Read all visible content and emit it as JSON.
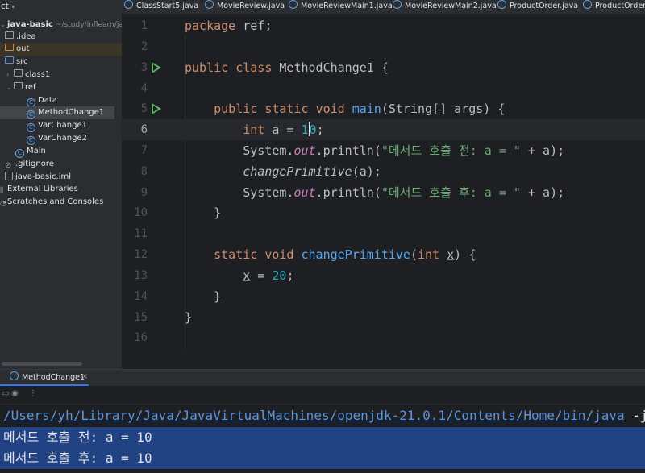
{
  "project": {
    "header": "ct",
    "root_name": "java-basic",
    "root_path": "~/study/inflearn/java/",
    "items": [
      {
        "label": ".idea",
        "kind": "folder"
      },
      {
        "label": "out",
        "kind": "folder-orange"
      },
      {
        "label": "src",
        "kind": "folder-blue"
      },
      {
        "label": "class1",
        "kind": "package"
      },
      {
        "label": "ref",
        "kind": "package"
      },
      {
        "label": "Data",
        "kind": "class"
      },
      {
        "label": "MethodChange1",
        "kind": "class"
      },
      {
        "label": "VarChange1",
        "kind": "class"
      },
      {
        "label": "VarChange2",
        "kind": "class"
      },
      {
        "label": "Main",
        "kind": "class"
      },
      {
        "label": ".gitignore",
        "kind": "file"
      },
      {
        "label": "java-basic.iml",
        "kind": "file"
      },
      {
        "label": "External Libraries",
        "kind": "lib"
      },
      {
        "label": "Scratches and Consoles",
        "kind": "scratch"
      }
    ]
  },
  "tabs": [
    "ClassStart5.java",
    "MovieReview.java",
    "MovieReviewMain1.java",
    "MovieReviewMain2.java",
    "ProductOrder.java",
    "ProductOrderM"
  ],
  "editor": {
    "line_numbers": [
      "1",
      "2",
      "3",
      "4",
      "5",
      "6",
      "7",
      "8",
      "9",
      "10",
      "11",
      "12",
      "13",
      "14",
      "15",
      "16"
    ],
    "current_line": 6,
    "code": {
      "l1_kw": "package",
      "l1_rest": " ref;",
      "l3_kw1": "public",
      "l3_kw2": "class",
      "l3_name": " MethodChange1 {",
      "l5_kw1": "public",
      "l5_kw2": "static",
      "l5_kw3": "void",
      "l5_fn": "main",
      "l5_rest": "(String[] args) {",
      "l6_kw": "int",
      "l6_mid": " a = ",
      "l6_num_a": "1",
      "l6_num_b": "0",
      "l6_end": ";",
      "l7_a": "System.",
      "l7_out": "out",
      "l7_b": ".println(",
      "l7_str": "\"메서드 호출 전: a = \"",
      "l7_c": " + a);",
      "l8_call": "changePrimitive",
      "l8_rest": "(a);",
      "l9_a": "System.",
      "l9_out": "out",
      "l9_b": ".println(",
      "l9_str": "\"메서드 호출 후: a = \"",
      "l9_c": " + a);",
      "l10": "}",
      "l12_kw1": "static",
      "l12_kw2": "void",
      "l12_fn": "changePrimitive",
      "l12_p1": "(",
      "l12_kw3": "int",
      "l12_x": "x",
      "l12_p2": ") {",
      "l13_x": "x",
      "l13_mid": " = ",
      "l13_num": "20",
      "l13_end": ";",
      "l14": "}",
      "l15": "}"
    }
  },
  "run": {
    "tab_label": "MethodChange1",
    "close": "×",
    "console": {
      "path_link": "/Users/yh/Library/Java/JavaVirtualMachines/openjdk-21.0.1/Contents/Home/bin/java",
      "path_rest": " -jav",
      "line1": "메서드 호출 전: a = 10",
      "line2": "메서드 호출 후: a = 10"
    }
  },
  "colors": {
    "keyword": "#cf8e6d",
    "function": "#56a8f5",
    "string": "#6aab73",
    "number": "#2aacb8",
    "static_field": "#c77dbb",
    "selection": "#214283"
  }
}
